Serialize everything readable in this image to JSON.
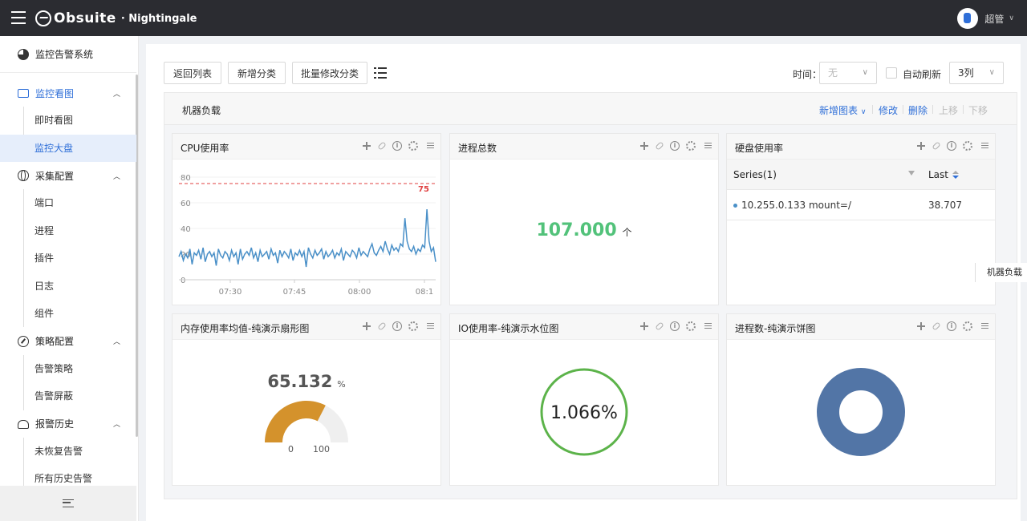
{
  "header": {
    "logo_text": "Obsuite",
    "logo_sub": "· Nightingale",
    "user_name": "超管"
  },
  "sidebar": {
    "system_title": "监控告警系统",
    "groups": [
      {
        "label": "监控看图",
        "items": [
          "即时看图",
          "监控大盘"
        ]
      },
      {
        "label": "采集配置",
        "items": [
          "端口",
          "进程",
          "插件",
          "日志",
          "组件"
        ]
      },
      {
        "label": "策略配置",
        "items": [
          "告警策略",
          "告警屏蔽"
        ]
      },
      {
        "label": "报警历史",
        "items": [
          "未恢复告警",
          "所有历史告警"
        ]
      }
    ],
    "active_item": "监控大盘"
  },
  "toolbar": {
    "back_label": "返回列表",
    "add_category_label": "新增分类",
    "batch_edit_label": "批量修改分类",
    "time_label": "时间：",
    "time_value": "无",
    "auto_refresh_label": "自动刷新",
    "columns_value": "3列"
  },
  "dashboard": {
    "title": "机器负载",
    "actions": {
      "add_chart": "新增图表",
      "edit": "修改",
      "delete": "删除",
      "move_up": "上移",
      "move_down": "下移"
    },
    "side_tab": "机器负载"
  },
  "panels": {
    "cpu": {
      "title": "CPU使用率"
    },
    "process_total": {
      "title": "进程总数",
      "value": "107.000",
      "unit": "个"
    },
    "disk": {
      "title": "硬盘使用率",
      "col_series": "Series(1)",
      "col_last": "Last",
      "row_series": "10.255.0.133 mount=/",
      "row_last": "38.707"
    },
    "memory": {
      "title": "内存使用率均值-纯演示扇形图",
      "value": "65.132",
      "unit": "%",
      "min_label": "0",
      "max_label": "100",
      "fraction": 0.65132
    },
    "io": {
      "title": "IO使用率-纯演示水位图",
      "value": "1.066%"
    },
    "proc_pie": {
      "title": "进程数-纯演示饼图"
    }
  },
  "colors": {
    "accent": "#2f6fd8",
    "number_green": "#52c27a",
    "gauge_orange": "#d4922c",
    "liquid_green": "#5cb34a",
    "donut_blue": "#5275a6",
    "line_blue": "#4a90c8",
    "threshold_red": "#e04040"
  },
  "chart_data": {
    "type": "line",
    "x_ticks": [
      "07:30",
      "07:45",
      "08:00",
      "08:1"
    ],
    "y_ticks": [
      0,
      20,
      40,
      60,
      80
    ],
    "ylim": [
      0,
      80
    ],
    "threshold": 75,
    "threshold_label": "75",
    "series": [
      {
        "values": [
          18,
          22,
          15,
          20,
          17,
          24,
          12,
          21,
          19,
          23,
          16,
          25,
          14,
          20,
          22,
          18,
          21,
          11,
          24,
          19,
          17,
          22,
          20,
          15,
          23,
          18,
          21,
          12,
          24,
          16,
          20,
          22,
          19,
          25,
          17,
          21,
          14,
          23,
          18,
          20,
          22,
          16,
          24,
          19,
          21,
          13,
          23,
          18,
          22,
          20,
          17,
          24,
          15,
          21,
          19,
          23,
          18,
          22,
          10,
          25,
          20,
          17,
          23,
          19,
          21,
          24,
          16,
          22,
          18,
          20,
          23,
          17,
          21,
          19,
          24,
          15,
          22,
          20,
          18,
          23,
          21,
          17,
          25,
          19,
          22,
          20,
          18,
          24,
          28,
          21,
          19,
          23,
          26,
          22,
          30,
          24,
          20,
          27,
          23,
          25,
          22,
          28,
          26,
          48,
          30,
          24,
          22,
          26,
          20,
          24,
          22,
          27,
          25,
          55,
          30,
          22,
          25,
          14
        ]
      }
    ]
  }
}
